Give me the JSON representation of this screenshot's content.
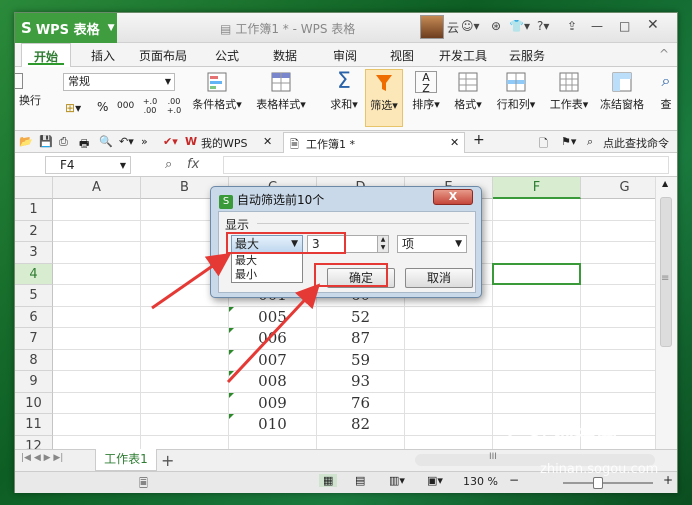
{
  "titlebar": {
    "app_name": "WPS 表格",
    "app_logo": "S",
    "doc_title": "工作簿1 * - WPS 表格",
    "cloud_label": "云"
  },
  "menu": {
    "tabs": [
      "开始",
      "插入",
      "页面布局",
      "公式",
      "数据",
      "审阅",
      "视图",
      "开发工具",
      "云服务"
    ]
  },
  "ribbon": {
    "number_format": "常规",
    "exec_label": "换行",
    "percent": "%",
    "thousand": "000",
    "dec_inc": "+.0 .00",
    "dec_dec": ".00 +.0",
    "items": [
      "条件格式",
      "表格样式",
      "求和",
      "筛选",
      "排序",
      "格式",
      "行和列",
      "工作表",
      "冻结窗格",
      "查"
    ]
  },
  "docbar": {
    "mywps": "我的WPS",
    "workbook": "工作簿1 *",
    "search": "点此查找命令"
  },
  "formula_bar": {
    "name_box": "F4",
    "fx": "fx"
  },
  "grid": {
    "columns": [
      "A",
      "B",
      "C",
      "D",
      "E",
      "F",
      "G"
    ],
    "rows": [
      "1",
      "2",
      "3",
      "4",
      "5",
      "6",
      "7",
      "8",
      "9",
      "10",
      "11",
      "12"
    ],
    "data": [
      {
        "row": "5",
        "c": "001",
        "d": "60"
      },
      {
        "row": "6",
        "c": "005",
        "d": "52"
      },
      {
        "row": "7",
        "c": "006",
        "d": "87"
      },
      {
        "row": "8",
        "c": "007",
        "d": "59"
      },
      {
        "row": "9",
        "c": "008",
        "d": "93"
      },
      {
        "row": "10",
        "c": "009",
        "d": "76"
      },
      {
        "row": "11",
        "c": "010",
        "d": "82"
      }
    ]
  },
  "sheetbar": {
    "sheet_name": "工作表1",
    "add": "+",
    "scroll_mark": "III"
  },
  "statusbar": {
    "zoom": "130 %"
  },
  "dialog": {
    "title": "自动筛选前10个",
    "close": "X",
    "section_label": "显示",
    "mode_selected": "最大",
    "mode_options": [
      "最大",
      "最小"
    ],
    "count_value": "3",
    "unit_selected": "项",
    "ok_label": "确定",
    "cancel_label": "取消"
  },
  "watermark": {
    "brand": "搜狗指南",
    "site": "zhinan.sogou.com"
  },
  "colors": {
    "accent_green": "#3a9a3a",
    "highlight_red": "#e53935",
    "dialog_blue": "#c9d9e9"
  }
}
